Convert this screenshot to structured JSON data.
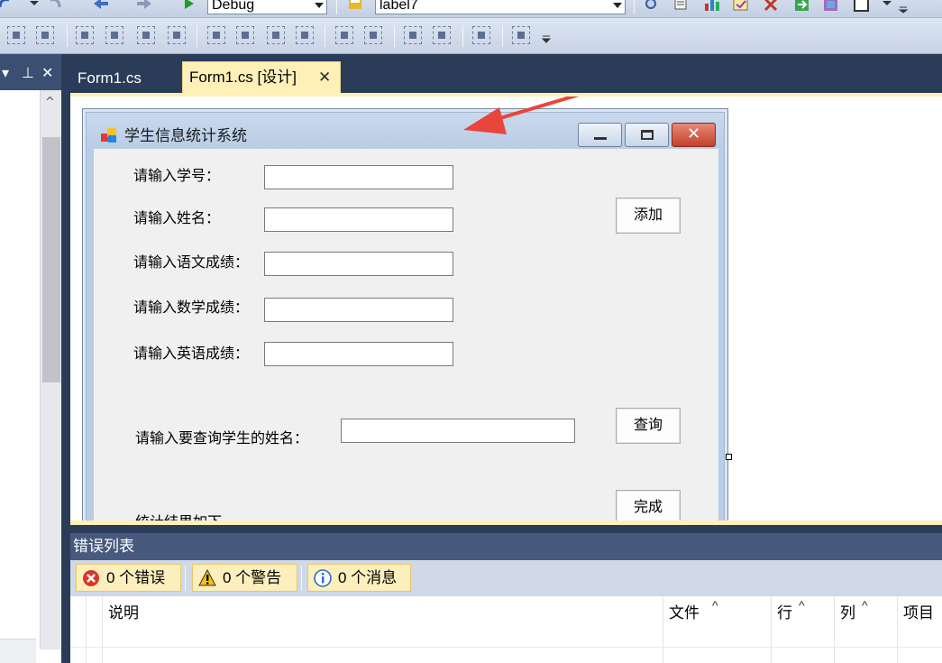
{
  "toolbar": {
    "config_combo": "Debug",
    "object_combo": "label7"
  },
  "tabs": [
    {
      "label": "Form1.cs",
      "active": false
    },
    {
      "label": "Form1.cs [设计]",
      "active": true,
      "close_glyph": "✕"
    }
  ],
  "form": {
    "title": "学生信息统计系统",
    "labels": {
      "student_id": "请输入学号：",
      "name": "请输入姓名：",
      "chinese": "请输入语文成绩：",
      "math": "请输入数学成绩：",
      "english": "请输入英语成绩：",
      "query_name": "请输入要查询学生的姓名：",
      "result": "统计结果如下"
    },
    "buttons": {
      "add": "添加",
      "query": "查询",
      "done": "完成"
    }
  },
  "error_list": {
    "title": "错误列表",
    "filters": {
      "errors": "0 个错误",
      "warnings": "0 个警告",
      "messages": "0 个消息"
    },
    "columns": [
      "说明",
      "文件",
      "行",
      "列",
      "项目"
    ]
  },
  "annotation": {
    "color": "#e8453c"
  },
  "colors": {
    "ide_dark": "#2b3c59",
    "tab_active": "#fff0b8",
    "error_header": "#475a7d"
  }
}
